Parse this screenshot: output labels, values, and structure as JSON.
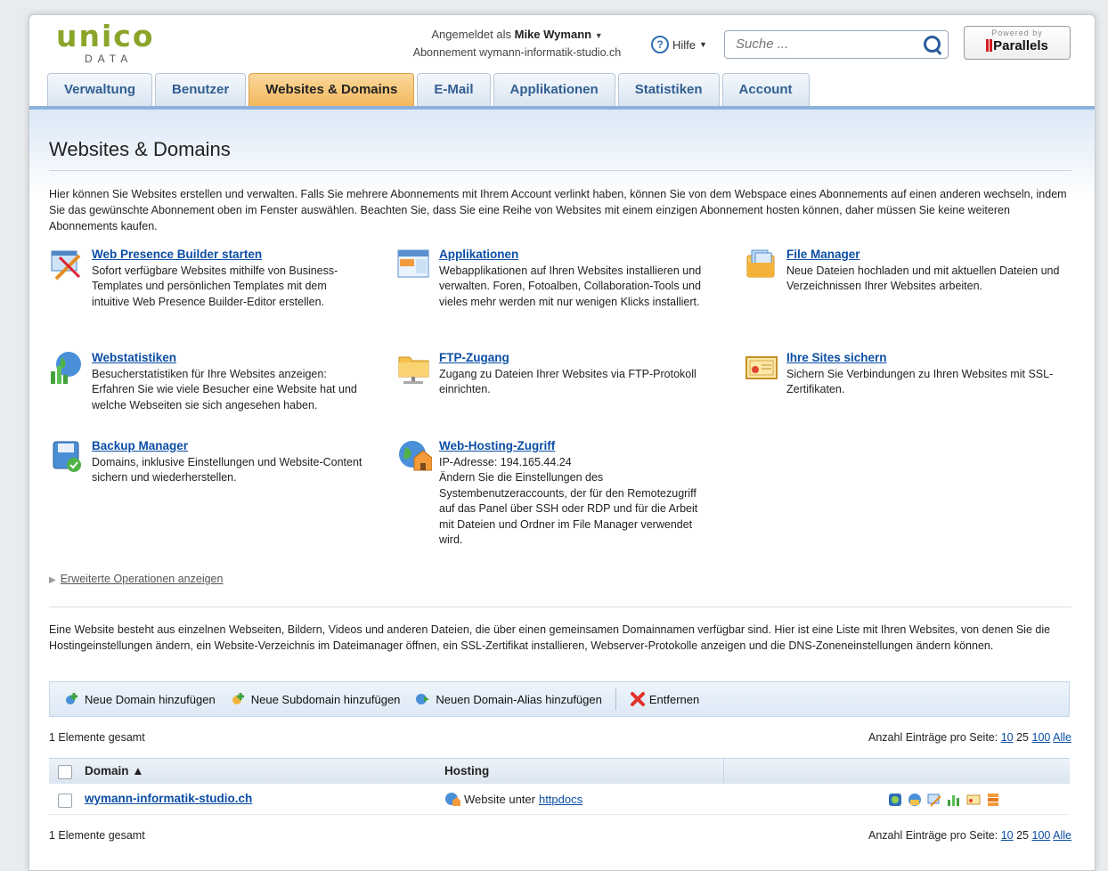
{
  "logo": {
    "main": "unico",
    "sub": "DATA"
  },
  "user": {
    "prefix": "Angemeldet als",
    "name": "Mike Wymann",
    "subscription": "Abonnement wymann-informatik-studio.ch"
  },
  "help": {
    "label": "Hilfe"
  },
  "search": {
    "placeholder": "Suche ..."
  },
  "powered": {
    "line1": "Powered by",
    "brand": "Parallels"
  },
  "tabs": [
    {
      "label": "Verwaltung"
    },
    {
      "label": "Benutzer"
    },
    {
      "label": "Websites & Domains"
    },
    {
      "label": "E-Mail"
    },
    {
      "label": "Applikationen"
    },
    {
      "label": "Statistiken"
    },
    {
      "label": "Account"
    }
  ],
  "page": {
    "title": "Websites & Domains",
    "intro": "Hier können Sie Websites erstellen und verwalten. Falls Sie mehrere Abonnements mit Ihrem Account verlinkt haben, können Sie von dem Webspace eines Abonnements auf einen anderen wechseln, indem Sie das gewünschte Abonnement oben im Fenster auswählen. Beachten Sie, dass Sie eine Reihe von Websites mit einem einzigen Abonnement hosten können, daher müssen Sie keine weiteren Abonnements kaufen."
  },
  "tools": [
    {
      "title": "Web Presence Builder starten",
      "desc": "Sofort verfügbare Websites mithilfe von Business-Templates und persönlichen Templates mit dem intuitive Web Presence Builder-Editor erstellen.",
      "icon": "web-presence-builder-icon"
    },
    {
      "title": "Applikationen",
      "desc": "Webapplikationen auf Ihren Websites installieren und verwalten. Foren, Fotoalben, Collaboration-Tools und vieles mehr werden mit nur wenigen Klicks installiert.",
      "icon": "applications-icon"
    },
    {
      "title": "File Manager",
      "desc": "Neue Dateien hochladen und mit aktuellen Dateien und Verzeichnissen Ihrer Websites arbeiten.",
      "icon": "file-manager-icon"
    },
    {
      "title": "Webstatistiken",
      "desc": "Besucherstatistiken für Ihre Websites anzeigen: Erfahren Sie wie viele Besucher eine Website hat und welche Webseiten sie sich angesehen haben.",
      "icon": "web-statistics-icon"
    },
    {
      "title": "FTP-Zugang",
      "desc": "Zugang zu Dateien Ihrer Websites via FTP-Protokoll einrichten.",
      "icon": "ftp-folder-icon"
    },
    {
      "title": "Ihre Sites sichern",
      "desc": "Sichern Sie Verbindungen zu Ihren Websites mit SSL-Zertifikaten.",
      "icon": "certificate-icon"
    },
    {
      "title": "Backup Manager",
      "desc": "Domains, inklusive Einstellungen und Website-Content sichern und wiederherstellen.",
      "icon": "backup-icon"
    },
    {
      "title": "Web-Hosting-Zugriff",
      "desc": "IP-Adresse: 194.165.44.24\nÄndern Sie die Einstellungen des Systembenutzeraccounts, der für den Remotezugriff auf das Panel über SSH oder RDP und für die Arbeit mit Dateien und Ordner im File Manager verwendet wird.",
      "icon": "hosting-access-icon"
    }
  ],
  "advanced": {
    "label": "Erweiterte Operationen anzeigen"
  },
  "intro2": "Eine Website besteht aus einzelnen Webseiten, Bildern, Videos und anderen Dateien, die über einen gemeinsamen Domainnamen verfügbar sind. Hier ist eine Liste mit Ihren Websites, von denen Sie die Hostingeinstellungen ändern, ein Website-Verzeichnis im Dateimanager öffnen, ein SSL-Zertifikat installieren, Webserver-Protokolle anzeigen und die DNS-Zoneneinstellungen ändern können.",
  "toolbar": {
    "add_domain": "Neue Domain hinzufügen",
    "add_subdomain": "Neue Subdomain hinzufügen",
    "add_alias": "Neuen Domain-Alias hinzufügen",
    "remove": "Entfernen"
  },
  "list": {
    "total": "1 Elemente gesamt",
    "per_page_label": "Anzahl Einträge pro Seite:",
    "per_page_options": [
      "10",
      "25",
      "100",
      "Alle"
    ],
    "col_domain": "Domain ▲",
    "col_hosting": "Hosting",
    "rows": [
      {
        "domain": "wymann-informatik-studio.ch",
        "hosting_prefix": "Website unter",
        "hosting_link": "httpdocs"
      }
    ]
  },
  "colors": {
    "accent_tab": "#f3b85d",
    "link": "#0b4ea5",
    "logo_green": "#8aa52a"
  }
}
